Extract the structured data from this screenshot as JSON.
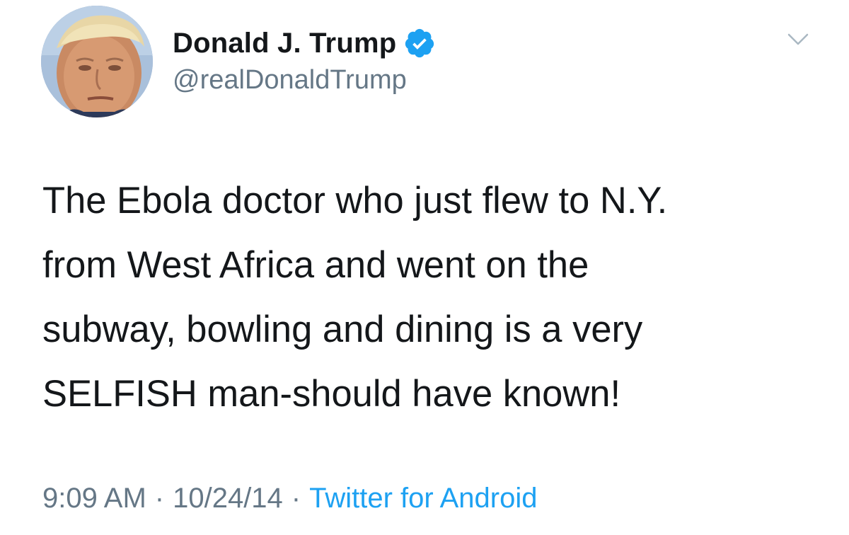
{
  "tweet": {
    "author": {
      "display_name": "Donald J. Trump",
      "handle": "@realDonaldTrump",
      "verified": true,
      "avatar_icon": "profile-photo"
    },
    "menu_icon": "chevron-down-icon",
    "text_lines": [
      "The Ebola doctor who just flew to N.Y.",
      "from West Africa and went on the",
      "subway, bowling and dining is a very",
      "SELFISH man-should have known!"
    ],
    "meta": {
      "time": "9:09 AM",
      "separator": "·",
      "date": "10/24/14",
      "source": "Twitter for Android"
    }
  },
  "colors": {
    "text_primary": "#14171a",
    "text_secondary": "#657786",
    "link_blue": "#1da1f2",
    "verified_blue": "#1da1f2",
    "caret_gray": "#aab8c2"
  }
}
